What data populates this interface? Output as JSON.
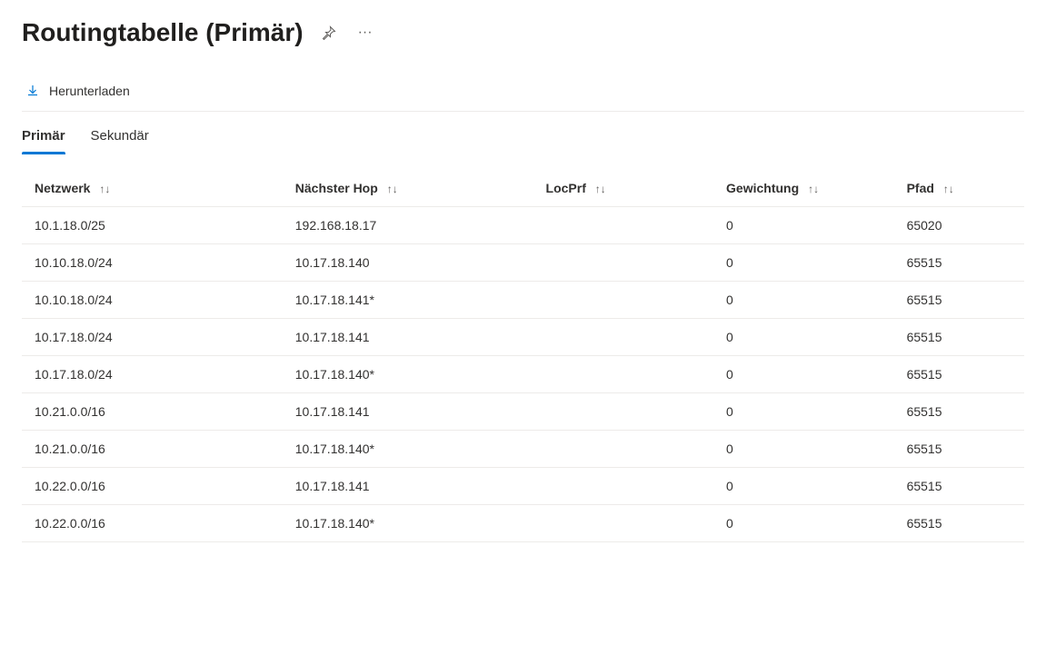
{
  "title": "Routingtabelle (Primär)",
  "toolbar": {
    "download_label": "Herunterladen"
  },
  "tabs": {
    "primary": "Primär",
    "secondary": "Sekundär"
  },
  "columns": {
    "network": "Netzwerk",
    "next_hop": "Nächster Hop",
    "loc_prf": "LocPrf",
    "weight": "Gewichtung",
    "path": "Pfad"
  },
  "rows": [
    {
      "network": "10.1.18.0/25",
      "next_hop": "192.168.18.17",
      "loc_prf": "",
      "weight": "0",
      "path": "65020"
    },
    {
      "network": "10.10.18.0/24",
      "next_hop": "10.17.18.140",
      "loc_prf": "",
      "weight": "0",
      "path": "65515"
    },
    {
      "network": "10.10.18.0/24",
      "next_hop": "10.17.18.141*",
      "loc_prf": "",
      "weight": "0",
      "path": "65515"
    },
    {
      "network": "10.17.18.0/24",
      "next_hop": "10.17.18.141",
      "loc_prf": "",
      "weight": "0",
      "path": "65515"
    },
    {
      "network": "10.17.18.0/24",
      "next_hop": "10.17.18.140*",
      "loc_prf": "",
      "weight": "0",
      "path": "65515"
    },
    {
      "network": "10.21.0.0/16",
      "next_hop": "10.17.18.141",
      "loc_prf": "",
      "weight": "0",
      "path": "65515"
    },
    {
      "network": "10.21.0.0/16",
      "next_hop": "10.17.18.140*",
      "loc_prf": "",
      "weight": "0",
      "path": "65515"
    },
    {
      "network": "10.22.0.0/16",
      "next_hop": "10.17.18.141",
      "loc_prf": "",
      "weight": "0",
      "path": "65515"
    },
    {
      "network": "10.22.0.0/16",
      "next_hop": "10.17.18.140*",
      "loc_prf": "",
      "weight": "0",
      "path": "65515"
    }
  ]
}
